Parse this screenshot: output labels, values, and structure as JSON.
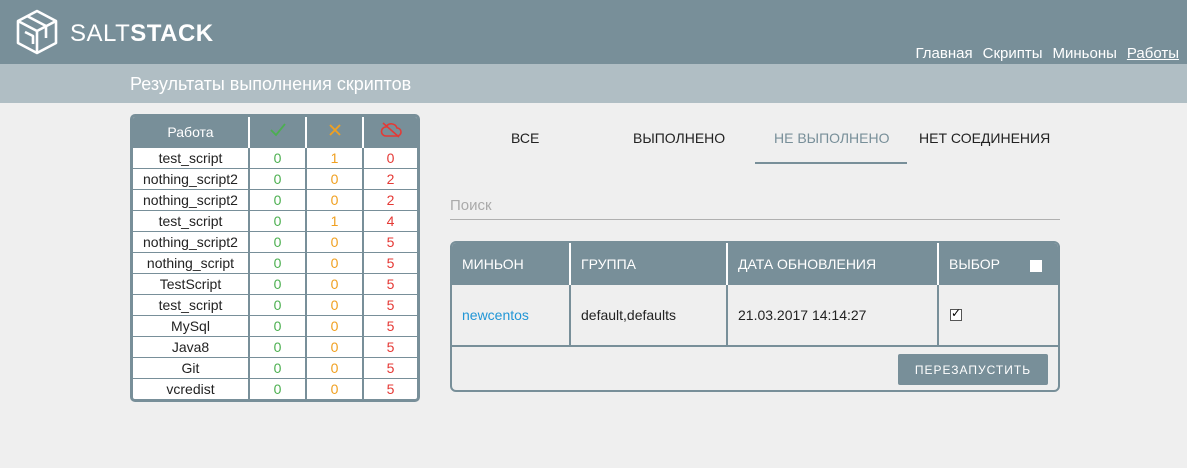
{
  "brand": {
    "salt": "SALT",
    "stack": "STACK"
  },
  "nav": {
    "items": [
      "Главная",
      "Скрипты",
      "Миньоны",
      "Работы"
    ],
    "active_index": 3
  },
  "subheader": {
    "title": "Результаты выполнения скриптов"
  },
  "jobs_table": {
    "header": {
      "name": "Работа",
      "ok_icon": "check-icon",
      "warn_icon": "cross-icon",
      "err_icon": "cloud-off-icon"
    },
    "rows": [
      {
        "name": "test_script",
        "ok": "0",
        "warn": "1",
        "err": "0"
      },
      {
        "name": "nothing_script2",
        "ok": "0",
        "warn": "0",
        "err": "2"
      },
      {
        "name": "nothing_script2",
        "ok": "0",
        "warn": "0",
        "err": "2"
      },
      {
        "name": "test_script",
        "ok": "0",
        "warn": "1",
        "err": "4"
      },
      {
        "name": "nothing_script2",
        "ok": "0",
        "warn": "0",
        "err": "5"
      },
      {
        "name": "nothing_script",
        "ok": "0",
        "warn": "0",
        "err": "5"
      },
      {
        "name": "TestScript",
        "ok": "0",
        "warn": "0",
        "err": "5"
      },
      {
        "name": "test_script",
        "ok": "0",
        "warn": "0",
        "err": "5"
      },
      {
        "name": "MySql",
        "ok": "0",
        "warn": "0",
        "err": "5"
      },
      {
        "name": "Java8",
        "ok": "0",
        "warn": "0",
        "err": "5"
      },
      {
        "name": "Git",
        "ok": "0",
        "warn": "0",
        "err": "5"
      },
      {
        "name": "vcredist",
        "ok": "0",
        "warn": "0",
        "err": "5"
      }
    ]
  },
  "tabs": {
    "all": "ВСЕ",
    "done": "ВЫПОЛНЕНО",
    "not_done": "НЕ ВЫПОЛНЕНО",
    "no_connection": "НЕТ СОЕДИНЕНИЯ",
    "active": "not_done"
  },
  "search": {
    "placeholder": "Поиск",
    "value": ""
  },
  "minions_table": {
    "headers": {
      "minion": "МИНЬОН",
      "group": "ГРУППА",
      "updated": "ДАТА ОБНОВЛЕНИЯ",
      "select": "ВЫБОР"
    },
    "select_all_checked": false,
    "rows": [
      {
        "minion": "newcentos",
        "group": "default,defaults",
        "updated": "21.03.2017 14:14:27",
        "selected": true
      }
    ],
    "restart_label": "ПЕРЕЗАПУСТИТЬ"
  },
  "colors": {
    "primary": "#788f99",
    "ok": "#4caf50",
    "warn": "#f0a020",
    "err": "#e53935",
    "link": "#2196d6"
  }
}
